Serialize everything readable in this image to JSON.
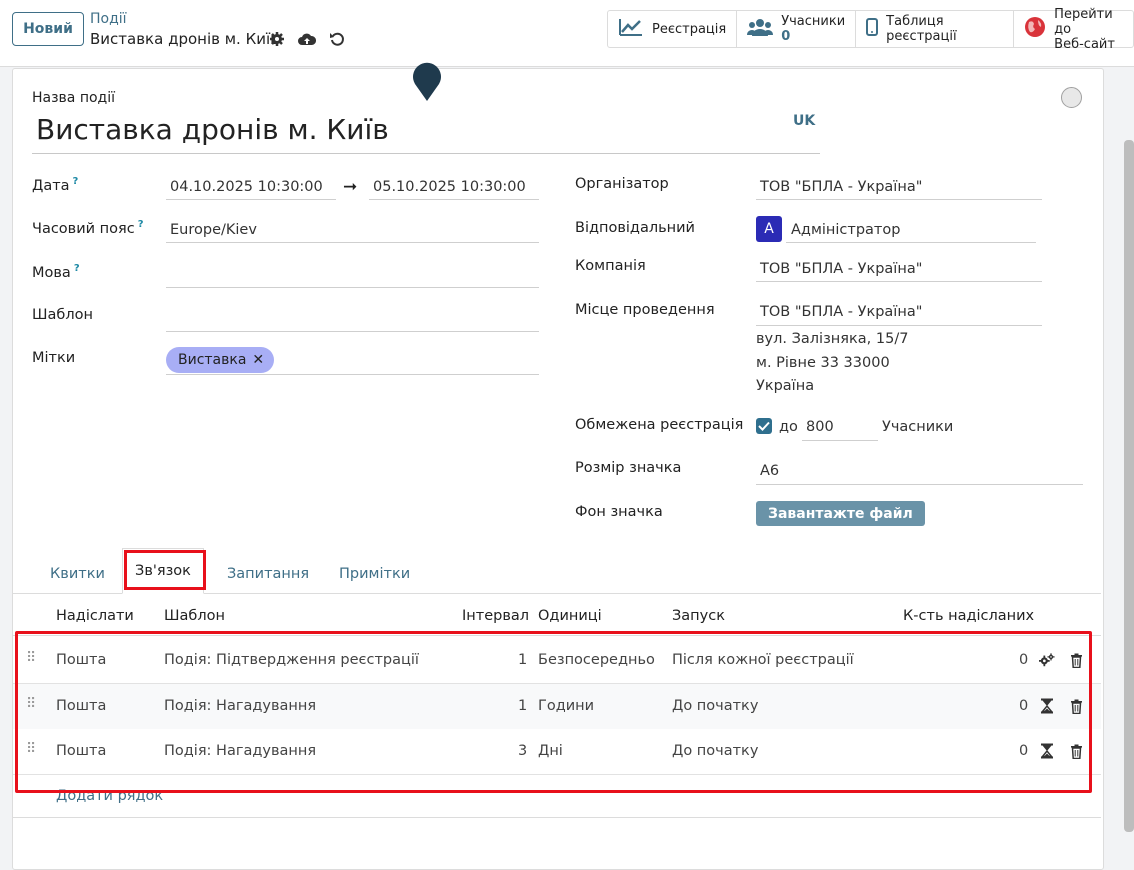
{
  "topbar": {
    "new_button": "Новий",
    "breadcrumb_parent": "Події",
    "breadcrumb_current": "Виставка дронів м. Київ",
    "smart_buttons": {
      "registration": "Реєстрація",
      "attendees_label": "Учасники",
      "attendees_count": "0",
      "registration_desk": "Таблиця реєстрації",
      "website_line1": "Перейти до",
      "website_line2": "Веб-сайт"
    }
  },
  "form": {
    "name_label": "Назва події",
    "name_value": "Виставка дронів м. Київ",
    "lang_badge": "UK",
    "date_label": "Дата",
    "date_help": "?",
    "date_begin": "04.10.2025 10:30:00",
    "date_end": "05.10.2025 10:30:00",
    "tz_label": "Часовий пояс",
    "tz_help": "?",
    "tz_value": "Europe/Kiev",
    "lang_label": "Мова",
    "lang_help": "?",
    "template_label": "Шаблон",
    "tags_label": "Мітки",
    "tag_value": "Виставка",
    "organizer_label": "Організатор",
    "organizer_value": "ТОВ \"БПЛА - Україна\"",
    "responsible_label": "Відповідальний",
    "responsible_avatar": "A",
    "responsible_value": "Адміністратор",
    "company_label": "Компанія",
    "company_value": "ТОВ \"БПЛА - Україна\"",
    "venue_label": "Місце проведення",
    "venue_value": "ТОВ \"БПЛА - Україна\"",
    "venue_address1": "вул. Залізняка, 15/7",
    "venue_address2": "м. Рівне 33 33000",
    "venue_address3": "Україна",
    "limit_label": "Обмежена реєстрація",
    "limit_to": "до",
    "limit_value": "800",
    "limit_unit": "Учасники",
    "badge_size_label": "Розмір значка",
    "badge_size_value": "A6",
    "badge_bg_label": "Фон значка",
    "upload_button": "Завантажте файл"
  },
  "tabs": {
    "tickets": "Квитки",
    "communication": "Зв'язок",
    "questions": "Запитання",
    "notes": "Примітки"
  },
  "mail_table": {
    "headers": {
      "send": "Надіслати",
      "template": "Шаблон",
      "interval": "Інтервал",
      "unit": "Одиниці",
      "trigger": "Запуск",
      "sent_count": "К-сть надісланих"
    },
    "rows": [
      {
        "send": "Пошта",
        "template": "Подія: Підтвердження реєстрації",
        "interval": "1",
        "unit": "Безпосередньо",
        "trigger": "Після кожної реєстрації",
        "sent": "0",
        "status_icon": "gears-icon"
      },
      {
        "send": "Пошта",
        "template": "Подія: Нагадування",
        "interval": "1",
        "unit": "Години",
        "trigger": "До початку",
        "sent": "0",
        "status_icon": "hourglass-icon"
      },
      {
        "send": "Пошта",
        "template": "Подія: Нагадування",
        "interval": "3",
        "unit": "Дні",
        "trigger": "До початку",
        "sent": "0",
        "status_icon": "hourglass-icon"
      }
    ],
    "add_line": "Додати рядок"
  },
  "colors": {
    "accent": "#3f6f87",
    "highlight_box": "#e8101b",
    "tag_bg": "#a8aef5",
    "avatar_bg": "#2b2bb5"
  }
}
